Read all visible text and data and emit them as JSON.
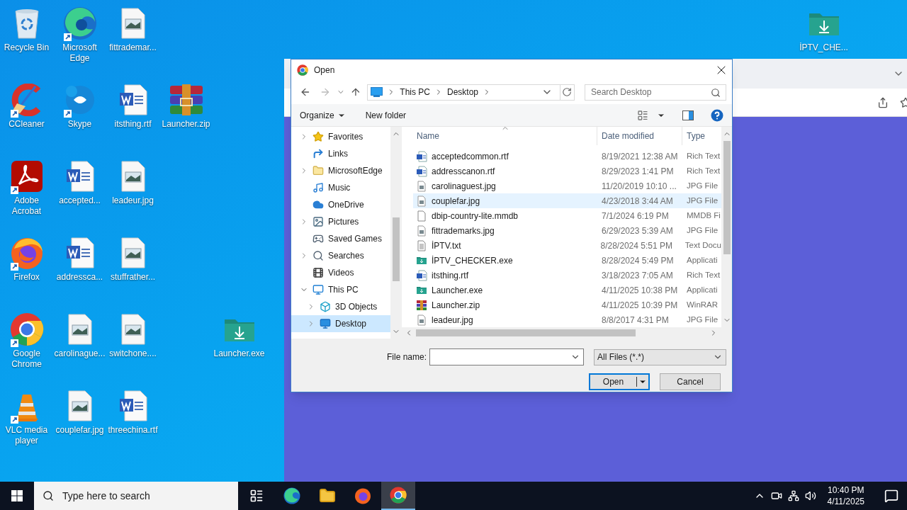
{
  "desktop": {
    "icons": [
      {
        "label": "Recycle Bin",
        "kind": "recycle",
        "shortcut": false
      },
      {
        "label": "CCleaner",
        "kind": "ccleaner",
        "shortcut": true
      },
      {
        "label": "Adobe Acrobat",
        "kind": "acrobat",
        "shortcut": true
      },
      {
        "label": "Firefox",
        "kind": "firefox",
        "shortcut": true
      },
      {
        "label": "Google Chrome",
        "kind": "chrome",
        "shortcut": true
      },
      {
        "label": "VLC media player",
        "kind": "vlc",
        "shortcut": true
      },
      {
        "label": "Microsoft Edge",
        "kind": "edge",
        "shortcut": true
      },
      {
        "label": "Skype",
        "kind": "skype",
        "shortcut": true
      },
      {
        "label": "accepted...",
        "kind": "word",
        "shortcut": false
      },
      {
        "label": "addressca...",
        "kind": "word",
        "shortcut": false
      },
      {
        "label": "carolinague...",
        "kind": "image",
        "shortcut": false
      },
      {
        "label": "couplefar.jpg",
        "kind": "image",
        "shortcut": false
      },
      {
        "label": "fittrademar...",
        "kind": "image",
        "shortcut": false
      },
      {
        "label": "itsthing.rtf",
        "kind": "word",
        "shortcut": false
      },
      {
        "label": "leadeur.jpg",
        "kind": "image",
        "shortcut": false
      },
      {
        "label": "stuffrather...",
        "kind": "image",
        "shortcut": false
      },
      {
        "label": "switchone....",
        "kind": "image",
        "shortcut": false
      },
      {
        "label": "threechina.rtf",
        "kind": "word",
        "shortcut": false
      },
      {
        "label": "Launcher.zip",
        "kind": "winrar",
        "shortcut": false
      },
      {
        "label": "Launcher.exe",
        "kind": "app-folder",
        "shortcut": false
      },
      {
        "label": "İPTV_CHE...",
        "kind": "app-folder",
        "shortcut": false
      }
    ]
  },
  "dialog": {
    "title": "Open",
    "breadcrumb": [
      "This PC",
      "Desktop"
    ],
    "search": {
      "placeholder": "Search Desktop"
    },
    "commands": {
      "organize": "Organize",
      "new_folder": "New folder"
    },
    "nav": [
      {
        "label": "Favorites",
        "kind": "star",
        "expandable": true,
        "expanded": false,
        "selected": false
      },
      {
        "label": "Links",
        "kind": "link",
        "expandable": false,
        "expanded": false,
        "selected": false
      },
      {
        "label": "MicrosoftEdge",
        "kind": "folder",
        "expandable": true,
        "expanded": false,
        "selected": false
      },
      {
        "label": "Music",
        "kind": "music",
        "expandable": false,
        "expanded": false,
        "selected": false
      },
      {
        "label": "OneDrive",
        "kind": "cloud",
        "expandable": false,
        "expanded": false,
        "selected": false
      },
      {
        "label": "Pictures",
        "kind": "pictures",
        "expandable": true,
        "expanded": false,
        "selected": false
      },
      {
        "label": "Saved Games",
        "kind": "games",
        "expandable": false,
        "expanded": false,
        "selected": false
      },
      {
        "label": "Searches",
        "kind": "search",
        "expandable": true,
        "expanded": false,
        "selected": false
      },
      {
        "label": "Videos",
        "kind": "videos",
        "expandable": false,
        "expanded": false,
        "selected": false
      },
      {
        "label": "This PC",
        "kind": "pc",
        "expandable": true,
        "expanded": true,
        "selected": false,
        "children": [
          {
            "label": "3D Objects",
            "kind": "cube",
            "expandable": true,
            "expanded": false,
            "selected": false
          },
          {
            "label": "Desktop",
            "kind": "desktop",
            "expandable": true,
            "expanded": false,
            "selected": true
          }
        ]
      }
    ],
    "columns": [
      "Name",
      "Date modified",
      "Type"
    ],
    "files": [
      {
        "name": "acceptedcommon.rtf",
        "date": "8/19/2021 12:38 AM",
        "type": "Rich Text",
        "kind": "word",
        "selected": false
      },
      {
        "name": "addresscanon.rtf",
        "date": "8/29/2023 1:41 PM",
        "type": "Rich Text",
        "kind": "word",
        "selected": false
      },
      {
        "name": "carolinaguest.jpg",
        "date": "11/20/2019 10:10 ...",
        "type": "JPG File",
        "kind": "image",
        "selected": false
      },
      {
        "name": "couplefar.jpg",
        "date": "4/23/2018 3:44 AM",
        "type": "JPG File",
        "kind": "image",
        "selected": true
      },
      {
        "name": "dbip-country-lite.mmdb",
        "date": "7/1/2024 6:19 PM",
        "type": "MMDB Fi",
        "kind": "blank",
        "selected": false
      },
      {
        "name": "fittrademarks.jpg",
        "date": "6/29/2023 5:39 AM",
        "type": "JPG File",
        "kind": "image",
        "selected": false
      },
      {
        "name": "İPTV.txt",
        "date": "8/28/2024 5:51 PM",
        "type": "Text Docu",
        "kind": "text",
        "selected": false
      },
      {
        "name": "İPTV_CHECKER.exe",
        "date": "8/28/2024 5:49 PM",
        "type": "Applicati",
        "kind": "app",
        "selected": false
      },
      {
        "name": "itsthing.rtf",
        "date": "3/18/2023 7:05 AM",
        "type": "Rich Text",
        "kind": "word",
        "selected": false
      },
      {
        "name": "Launcher.exe",
        "date": "4/11/2025 10:38 PM",
        "type": "Applicati",
        "kind": "app",
        "selected": false
      },
      {
        "name": "Launcher.zip",
        "date": "4/11/2025 10:39 PM",
        "type": "WinRAR",
        "kind": "winrar",
        "selected": false
      },
      {
        "name": "leadeur.jpg",
        "date": "8/8/2017 4:31 PM",
        "type": "JPG File",
        "kind": "image",
        "selected": false
      }
    ],
    "file_name_label": "File name:",
    "filter": "All Files (*.*)",
    "buttons": {
      "open": "Open",
      "cancel": "Cancel"
    }
  },
  "taskbar": {
    "search": {
      "placeholder": "Type here to search"
    },
    "apps": [
      {
        "kind": "taskview",
        "active": false
      },
      {
        "kind": "edge",
        "active": false
      },
      {
        "kind": "explorer",
        "active": false
      },
      {
        "kind": "firefox",
        "active": false
      },
      {
        "kind": "chrome",
        "active": true
      }
    ],
    "time": "10:40 PM",
    "date": "4/11/2025"
  }
}
